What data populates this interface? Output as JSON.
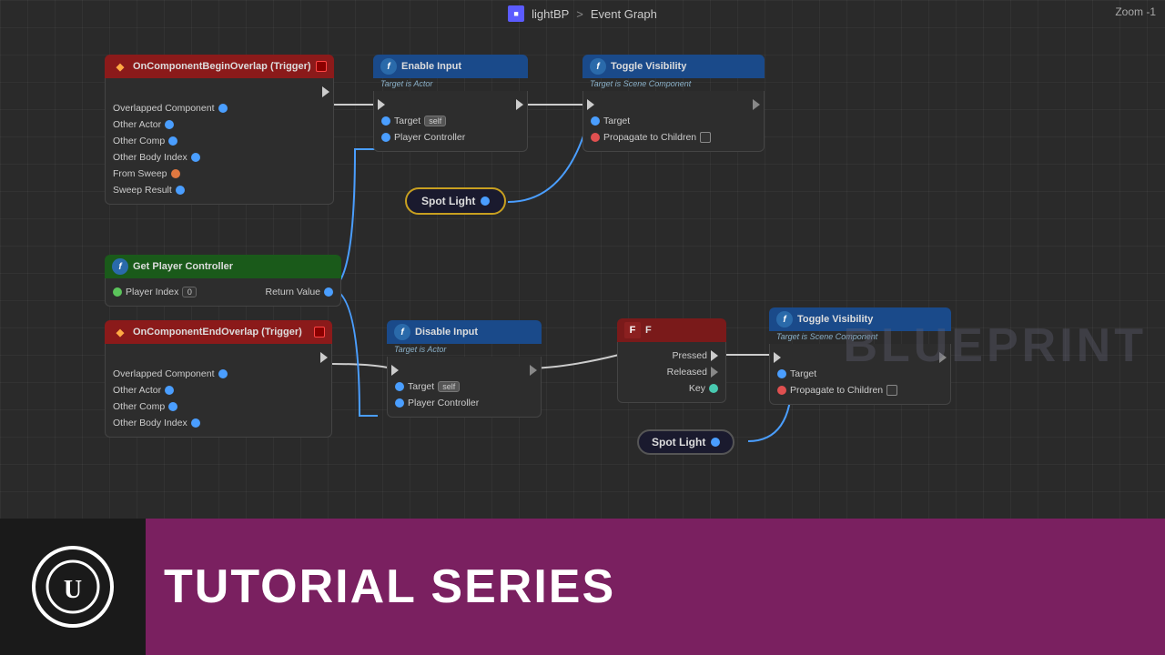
{
  "topbar": {
    "breadcrumb1": "lightBP",
    "separator": ">",
    "breadcrumb2": "Event Graph",
    "zoom": "Zoom -1"
  },
  "nodes": {
    "onBeginOverlap": {
      "title": "OnComponentBeginOverlap (Trigger)",
      "pins": [
        "Overlapped Component",
        "Other Actor",
        "Other Comp",
        "Other Body Index",
        "From Sweep",
        "Sweep Result"
      ]
    },
    "enableInput": {
      "title": "Enable Input",
      "subtitle": "Target is Actor",
      "pins_in": [
        "Target"
      ],
      "pins_out": [
        "Player Controller"
      ],
      "self_label": "self"
    },
    "toggleVisibility1": {
      "title": "Toggle Visibility",
      "subtitle": "Target is Scene Component",
      "pins": [
        "Target",
        "Propagate to Children"
      ]
    },
    "spotLight1": {
      "label": "Spot Light"
    },
    "getPlayerController": {
      "title": "Get Player Controller",
      "player_index_label": "Player Index",
      "player_index_value": "0",
      "return_label": "Return Value"
    },
    "onEndOverlap": {
      "title": "OnComponentEndOverlap (Trigger)",
      "pins": [
        "Overlapped Component",
        "Other Actor",
        "Other Comp",
        "Other Body Index"
      ]
    },
    "disableInput": {
      "title": "Disable Input",
      "subtitle": "Target is Actor",
      "pins_in": [
        "Target"
      ],
      "pins_out": [
        "Player Controller"
      ],
      "self_label": "self"
    },
    "fKey": {
      "title": "F",
      "pins": [
        "Pressed",
        "Released",
        "Key"
      ]
    },
    "toggleVisibility2": {
      "title": "Toggle Visibility",
      "subtitle": "Target is Scene Component",
      "pins": [
        "Target",
        "Propagate to Children"
      ]
    },
    "spotLight2": {
      "label": "Spot Light"
    }
  },
  "bottomBar": {
    "title": "TUTORIAL SERIES",
    "watermark": "BLUEPRINT"
  },
  "colors": {
    "canvasBg": "#2a2a2a",
    "redHeader": "#8b1a1a",
    "blueHeader": "#1a4a8a",
    "greenHeader": "#1a5a1a",
    "nodeBorder": "#444",
    "spotlightBorder": "#c8a020",
    "bottomBarBg": "#7a2060"
  }
}
